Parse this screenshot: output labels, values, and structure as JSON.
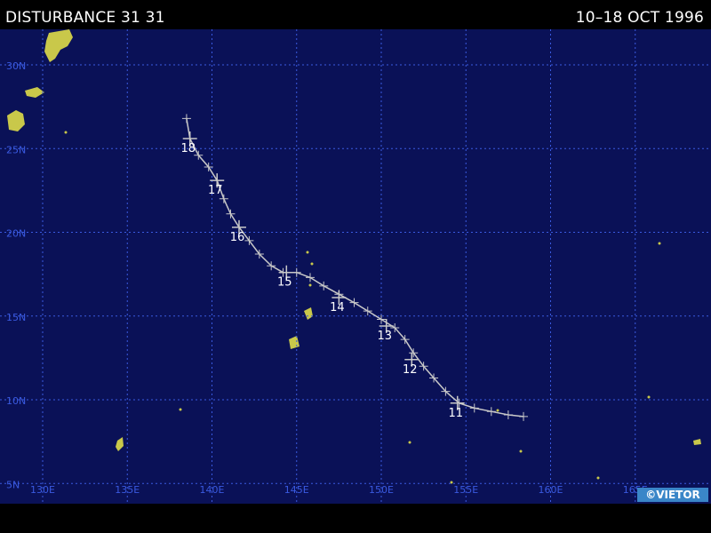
{
  "header": {
    "title": "DISTURBANCE 31 31",
    "date_range": "10–18 OCT 1996"
  },
  "credit": "©VIETOR",
  "map": {
    "ocean_color": "#0a1157",
    "grid_color": "#3a5ae0",
    "land_color": "#c9c84a",
    "track_color": "#c8c8c8",
    "lon_labels": [
      "130E",
      "135E",
      "140E",
      "145E",
      "150E",
      "155E",
      "160E",
      "165E"
    ],
    "lat_labels": [
      "30N",
      "25N",
      "20N",
      "15N",
      "10N",
      "5N"
    ],
    "lon_values": [
      130,
      135,
      140,
      145,
      150,
      155,
      160,
      165
    ],
    "lat_values": [
      30,
      25,
      20,
      15,
      10,
      5
    ]
  },
  "track": {
    "points": [
      {
        "lon": 158.4,
        "lat": 9.0
      },
      {
        "lon": 157.5,
        "lat": 9.1
      },
      {
        "lon": 156.5,
        "lat": 9.3
      },
      {
        "lon": 155.5,
        "lat": 9.5
      },
      {
        "lon": 154.6,
        "lat": 9.8
      },
      {
        "lon": 153.8,
        "lat": 10.5
      },
      {
        "lon": 153.1,
        "lat": 11.3
      },
      {
        "lon": 152.5,
        "lat": 12.0
      },
      {
        "lon": 151.9,
        "lat": 12.8
      },
      {
        "lon": 151.4,
        "lat": 13.6
      },
      {
        "lon": 150.8,
        "lat": 14.3
      },
      {
        "lon": 150.0,
        "lat": 14.8
      },
      {
        "lon": 149.2,
        "lat": 15.3
      },
      {
        "lon": 148.4,
        "lat": 15.8
      },
      {
        "lon": 147.5,
        "lat": 16.3
      },
      {
        "lon": 146.6,
        "lat": 16.8
      },
      {
        "lon": 145.8,
        "lat": 17.3
      },
      {
        "lon": 145.0,
        "lat": 17.6
      },
      {
        "lon": 144.2,
        "lat": 17.6
      },
      {
        "lon": 143.5,
        "lat": 18.0
      },
      {
        "lon": 142.8,
        "lat": 18.7
      },
      {
        "lon": 142.2,
        "lat": 19.5
      },
      {
        "lon": 141.6,
        "lat": 20.3
      },
      {
        "lon": 141.1,
        "lat": 21.1
      },
      {
        "lon": 140.7,
        "lat": 22.0
      },
      {
        "lon": 140.3,
        "lat": 23.1
      },
      {
        "lon": 139.8,
        "lat": 23.9
      },
      {
        "lon": 139.2,
        "lat": 24.6
      },
      {
        "lon": 138.7,
        "lat": 25.6
      },
      {
        "lon": 138.5,
        "lat": 26.8
      }
    ],
    "day_markers": [
      {
        "label": "11",
        "lon": 154.5,
        "lat": 9.8
      },
      {
        "label": "12",
        "lon": 151.8,
        "lat": 12.4
      },
      {
        "label": "13",
        "lon": 150.3,
        "lat": 14.4
      },
      {
        "label": "14",
        "lon": 147.5,
        "lat": 16.1
      },
      {
        "label": "15",
        "lon": 144.4,
        "lat": 17.6
      },
      {
        "label": "16",
        "lon": 141.6,
        "lat": 20.3
      },
      {
        "label": "17",
        "lon": 140.3,
        "lat": 23.1
      },
      {
        "label": "18",
        "lon": 138.7,
        "lat": 25.6
      }
    ]
  }
}
